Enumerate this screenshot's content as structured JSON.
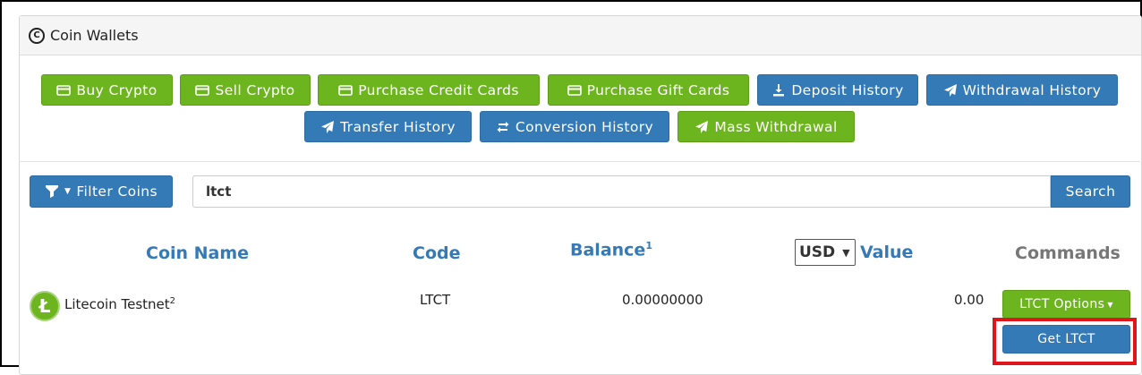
{
  "panel": {
    "title": "Coin Wallets",
    "title_icon": "copyright-circle-icon"
  },
  "action_buttons": [
    {
      "label": "Buy Crypto",
      "color": "#6db51e",
      "icon": "credit-card-icon"
    },
    {
      "label": "Sell Crypto",
      "color": "#6db51e",
      "icon": "credit-card-icon"
    },
    {
      "label": "Purchase Credit Cards",
      "color": "#6db51e",
      "icon": "credit-card-icon"
    },
    {
      "label": "Purchase Gift Cards",
      "color": "#6db51e",
      "icon": "credit-card-icon"
    },
    {
      "label": "Deposit History",
      "color": "#337ab7",
      "icon": "download-icon"
    },
    {
      "label": "Withdrawal History",
      "color": "#337ab7",
      "icon": "send-icon"
    },
    {
      "label": "Transfer History",
      "color": "#337ab7",
      "icon": "send-icon"
    },
    {
      "label": "Conversion History",
      "color": "#337ab7",
      "icon": "exchange-icon"
    },
    {
      "label": "Mass Withdrawal",
      "color": "#6db51e",
      "icon": "send-icon"
    }
  ],
  "filter": {
    "button_label": "Filter Coins",
    "search_value": "ltct",
    "search_button_label": "Search"
  },
  "table": {
    "headers": {
      "coin_name": "Coin Name",
      "code": "Code",
      "balance": "Balance",
      "balance_note": "1",
      "currency": "USD",
      "value": "Value",
      "commands": "Commands"
    },
    "rows": [
      {
        "coin_name": "Litecoin Testnet",
        "coin_note": "2",
        "code": "LTCT",
        "balance": "0.00000000",
        "value": "0.00",
        "options_label": "LTCT Options",
        "get_label": "Get LTCT",
        "logo_letter": "Ł"
      }
    ]
  },
  "colors": {
    "green": "#6db51e",
    "blue": "#337ab7",
    "highlight": "#e0151b"
  }
}
